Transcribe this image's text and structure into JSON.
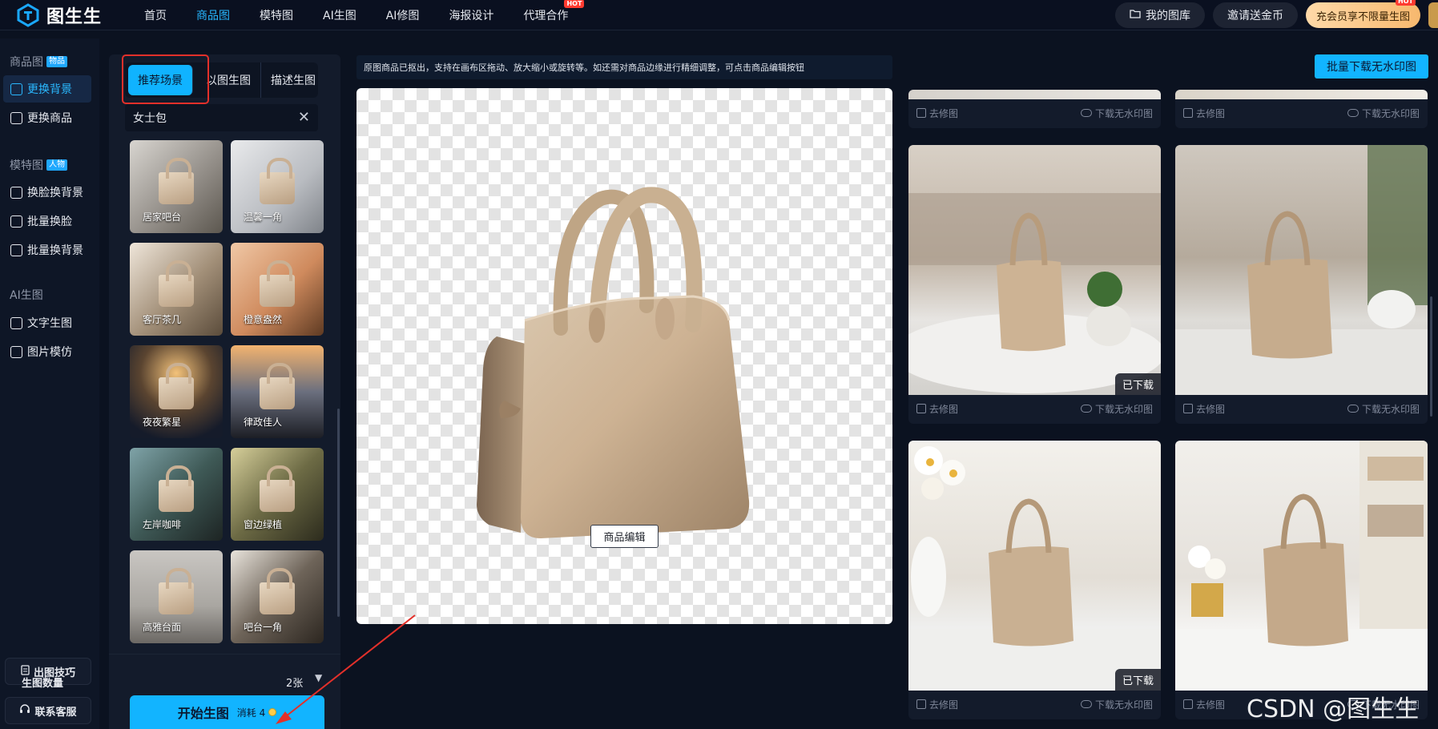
{
  "app": {
    "name": "图生生"
  },
  "nav": {
    "items": [
      {
        "label": "首页"
      },
      {
        "label": "商品图"
      },
      {
        "label": "模特图"
      },
      {
        "label": "AI生图"
      },
      {
        "label": "AI修图"
      },
      {
        "label": "海报设计"
      },
      {
        "label": "代理合作"
      }
    ],
    "hot_badge": "HOT",
    "gallery_label": "我的图库",
    "invite_label": "邀请送金币",
    "vip_label": "充会员享不限量生图"
  },
  "sidebar": {
    "group_product": "商品图",
    "group_product_tag": "物品",
    "item_change_bg": "更换背景",
    "item_change_product": "更换商品",
    "group_model": "模特图",
    "group_model_tag": "人物",
    "item_face_bg": "换脸换背景",
    "item_batch_face": "批量换脸",
    "item_batch_bg": "批量换背景",
    "group_ai": "AI生图",
    "item_text_gen": "文字生图",
    "item_img_imitate": "图片模仿",
    "tips_label": "出图技巧",
    "support_label": "联系客服"
  },
  "panel": {
    "tabs": [
      "推荐场景",
      "以图生图",
      "描述生图"
    ],
    "search_value": "女士包",
    "scenes": [
      {
        "label": "居家吧台"
      },
      {
        "label": "温馨一角"
      },
      {
        "label": "客厅茶几"
      },
      {
        "label": "橙意盎然"
      },
      {
        "label": "夜夜繁星"
      },
      {
        "label": "律政佳人"
      },
      {
        "label": "左岸咖啡"
      },
      {
        "label": "窗边绿植"
      },
      {
        "label": "高雅台面"
      },
      {
        "label": "吧台一角"
      }
    ],
    "count_label": "生图数量",
    "count_value": "2张",
    "start_label": "开始生图",
    "cost_label": "消耗 4"
  },
  "canvas": {
    "notice": "原图商品已抠出，支持在画布区拖动、放大缩小或旋转等。如还需对商品边缘进行精细调整，可点击商品编辑按钮",
    "edit_label": "商品编辑"
  },
  "results": {
    "batch_download_label": "批量下载无水印图",
    "edit_label": "去修图",
    "download_label": "下载无水印图",
    "downloaded_badge": "已下载"
  },
  "watermark": "CSDN @图生生",
  "colors": {
    "accent": "#12b4ff",
    "background": "#0b1220",
    "highlight_box": "#e3302a"
  }
}
